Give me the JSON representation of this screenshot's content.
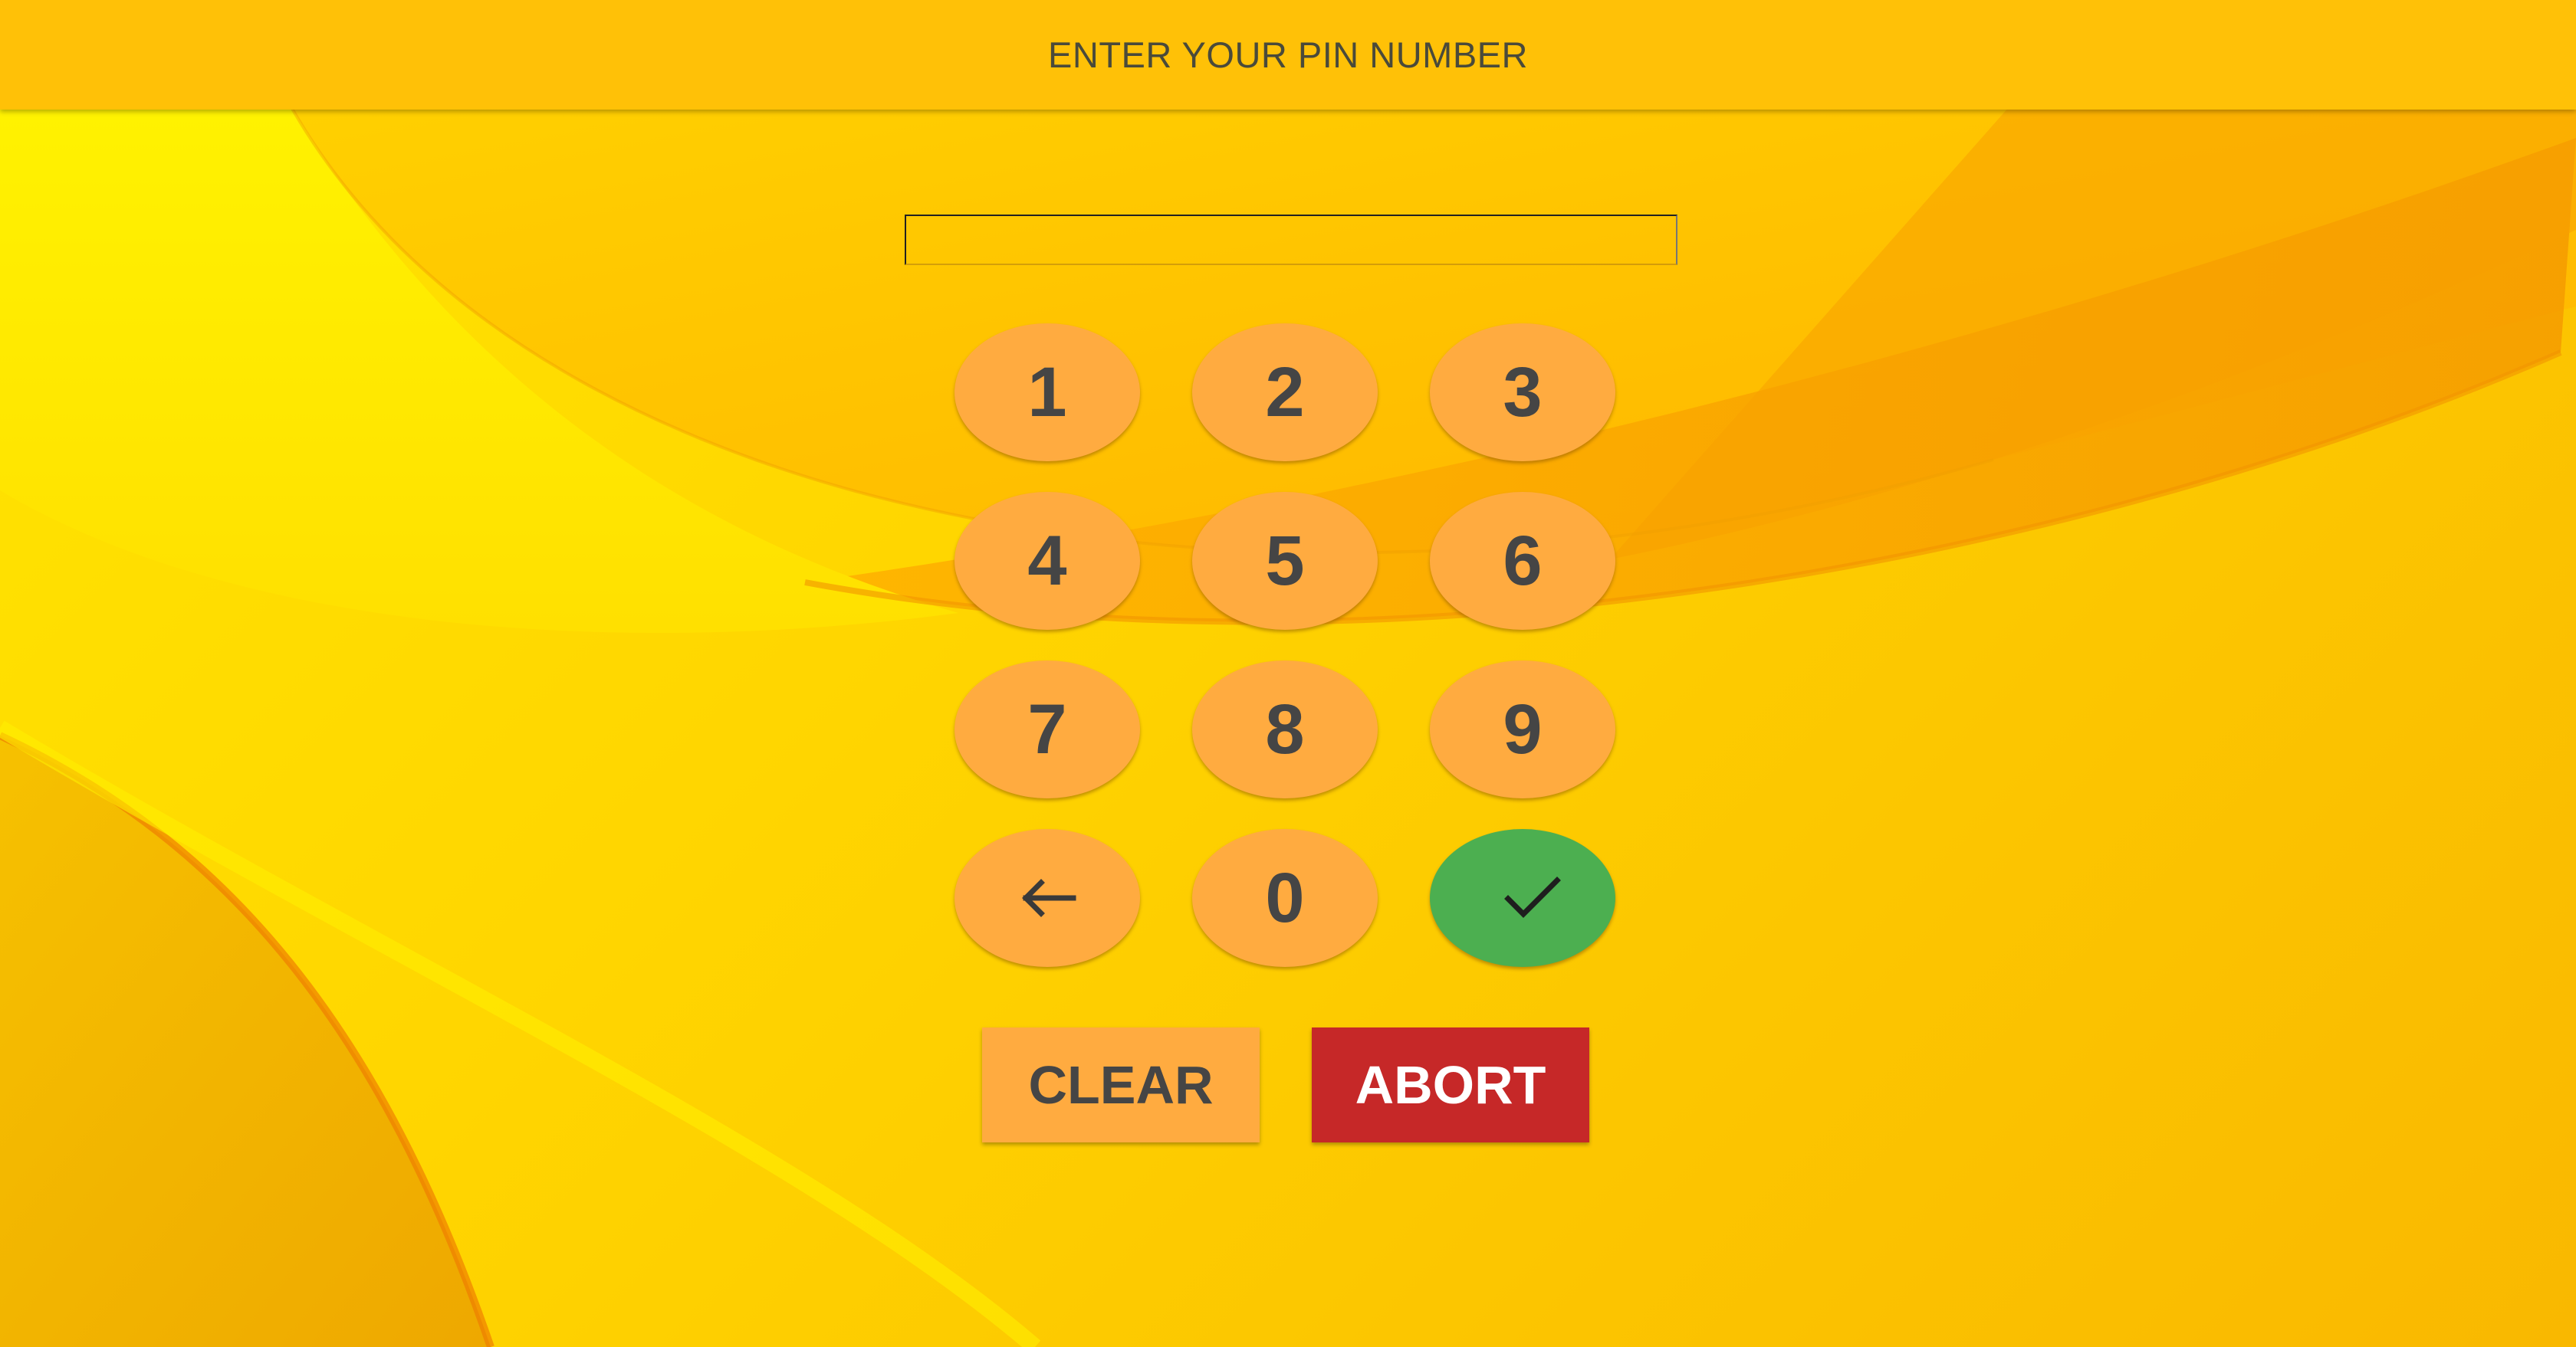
{
  "header": {
    "title": "ENTER YOUR PIN NUMBER"
  },
  "pin_input": {
    "value": ""
  },
  "keypad": {
    "keys": [
      "1",
      "2",
      "3",
      "4",
      "5",
      "6",
      "7",
      "8",
      "9"
    ],
    "zero": "0",
    "backspace_icon": "arrow-left-icon",
    "confirm_icon": "check-icon"
  },
  "actions": {
    "clear_label": "CLEAR",
    "abort_label": "ABORT"
  },
  "colors": {
    "topbar": "#ffc107",
    "key": "#ffab40",
    "confirm": "#4caf50",
    "abort": "#c62828"
  }
}
